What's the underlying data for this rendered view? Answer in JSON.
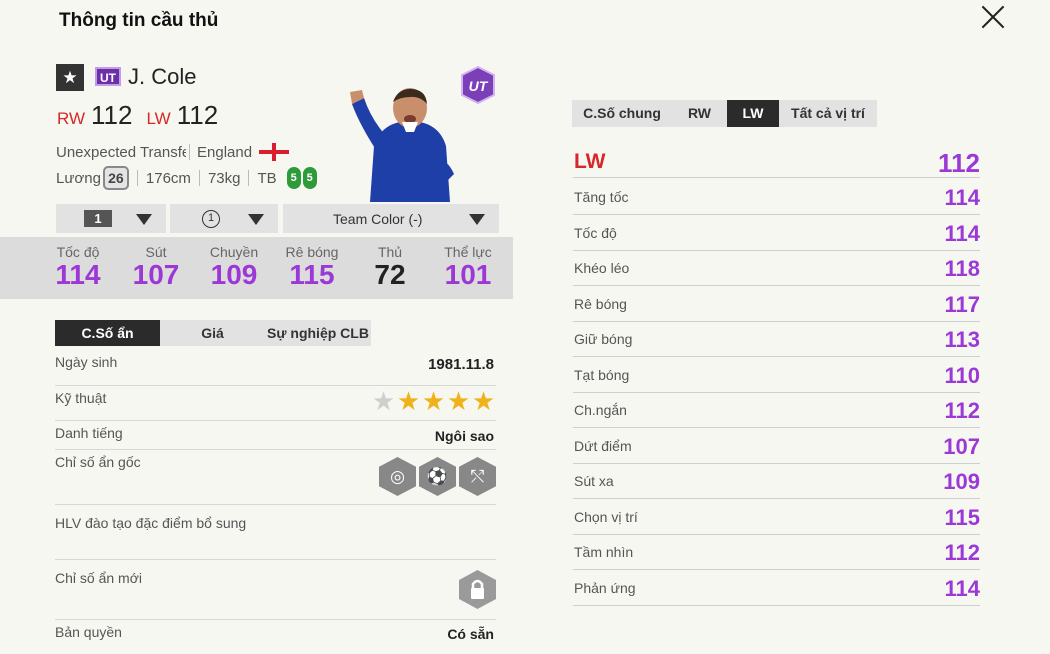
{
  "header": {
    "title": "Thông tin cầu thủ"
  },
  "player": {
    "name": "J. Cole",
    "season_code": "UT",
    "star": "★",
    "pos1": "RW",
    "ovr1": "112",
    "pos2": "LW",
    "ovr2": "112",
    "club": "Unexpected Transfer",
    "nation": "England",
    "salary_label": "Lương",
    "salary": "26",
    "height": "176cm",
    "weight": "73kg",
    "body": "TB",
    "left_foot": "5",
    "right_foot": "5"
  },
  "selectors": {
    "level": "1",
    "trait": "1",
    "team_color": "Team Color (-)"
  },
  "summary_stats": [
    {
      "label": "Tốc độ",
      "value": "114"
    },
    {
      "label": "Sút",
      "value": "107"
    },
    {
      "label": "Chuyền",
      "value": "109"
    },
    {
      "label": "Rê bóng",
      "value": "115"
    },
    {
      "label": "Thủ",
      "value": "72"
    },
    {
      "label": "Thể lực",
      "value": "101"
    }
  ],
  "left_tabs": [
    "C.Số ẩn",
    "Giá",
    "Sự nghiệp CLB"
  ],
  "details": {
    "birth_label": "Ngày sinh",
    "birth": "1981.11.8",
    "skill_label": "Kỹ thuật",
    "skill_stars": 4,
    "fame_label": "Danh tiếng",
    "fame": "Ngôi sao",
    "hidden_label": "Chỉ số ẩn gốc",
    "coach_label": "HLV đào tạo đặc điểm bổ sung",
    "new_hidden_label": "Chỉ số ẩn mới",
    "license_label": "Bản quyền",
    "license": "Có sẵn"
  },
  "right_tabs": [
    "C.Số chung",
    "RW",
    "LW",
    "Tất cả vị trí"
  ],
  "position_detail": {
    "position": "LW",
    "ovr": "112",
    "attributes": [
      {
        "label": "Tăng tốc",
        "value": "114"
      },
      {
        "label": "Tốc độ",
        "value": "114"
      },
      {
        "label": "Khéo léo",
        "value": "118"
      },
      {
        "label": "Rê bóng",
        "value": "117"
      },
      {
        "label": "Giữ bóng",
        "value": "113"
      },
      {
        "label": "Tạt bóng",
        "value": "110"
      },
      {
        "label": "Ch.ngắn",
        "value": "112"
      },
      {
        "label": "Dứt điểm",
        "value": "107"
      },
      {
        "label": "Sút xa",
        "value": "109"
      },
      {
        "label": "Chọn vị trí",
        "value": "115"
      },
      {
        "label": "Tầm nhìn",
        "value": "112"
      },
      {
        "label": "Phản ứng",
        "value": "114"
      }
    ]
  },
  "colors": {
    "accent_purple": "#9b38d6",
    "position_red": "#d62828",
    "dark_tab": "#2b2b2b"
  },
  "icons": [
    "close-icon",
    "star-icon",
    "flag-icon",
    "chevron-down-icon",
    "lock-icon",
    "trait-icon"
  ]
}
